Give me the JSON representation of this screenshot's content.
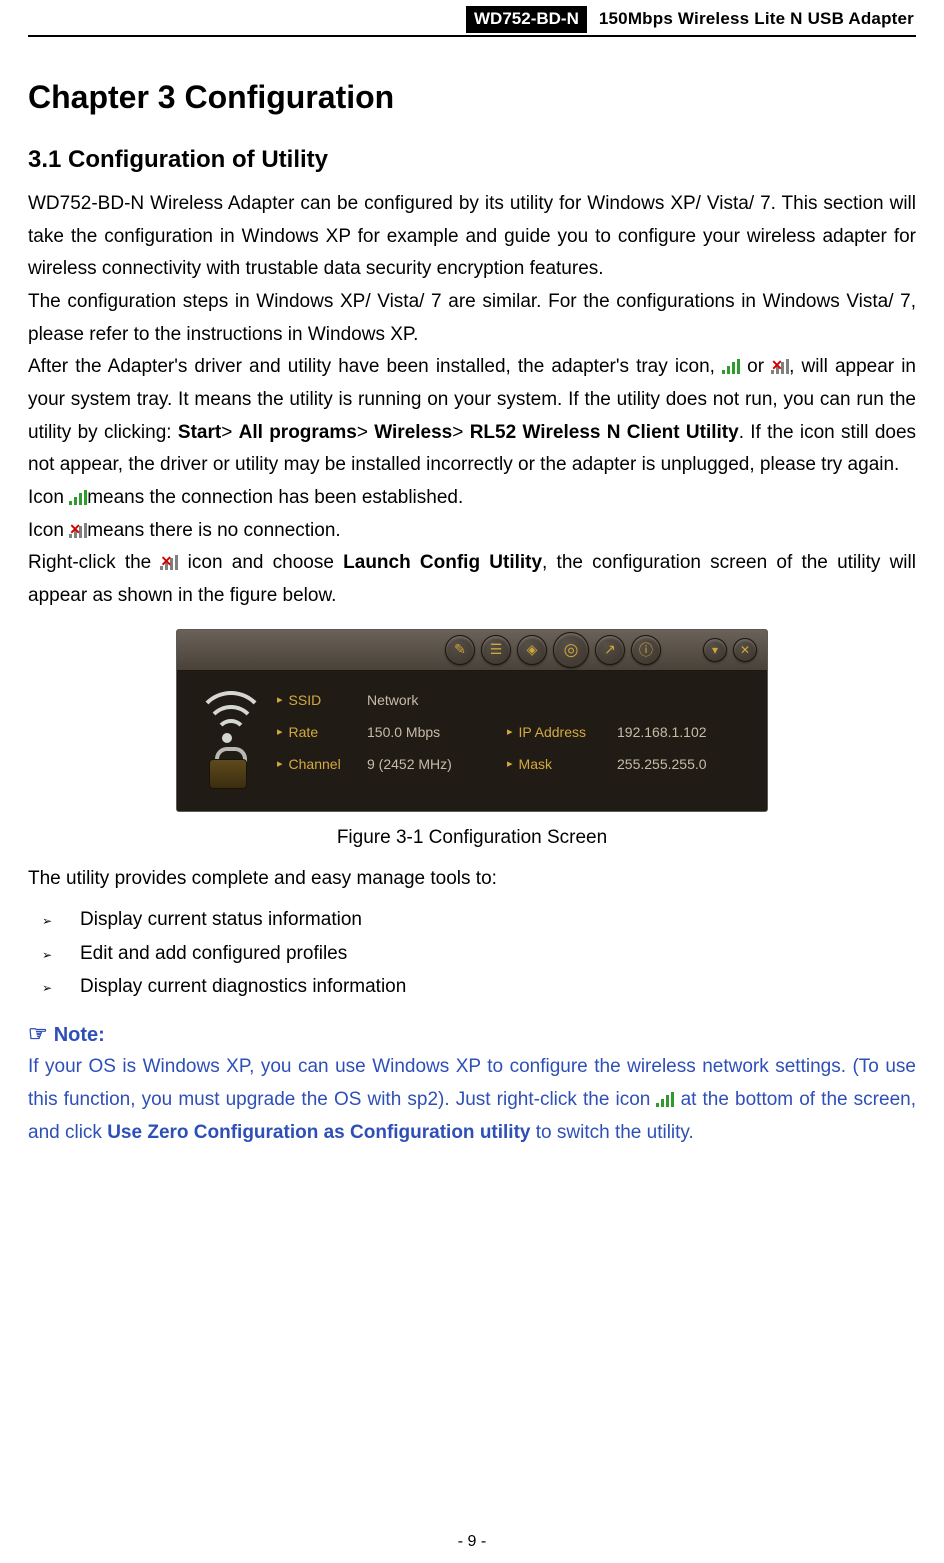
{
  "header": {
    "model": "WD752-BD-N",
    "description": "150Mbps Wireless Lite N USB Adapter"
  },
  "chapter_title": "Chapter 3   Configuration",
  "section_title": "3.1   Configuration of Utility",
  "para1_a": "WD752-BD-N Wireless Adapter can be configured by its utility for Windows XP/ Vista/ 7. This section will take the configuration in Windows XP for example and guide you to configure your wireless adapter for wireless connectivity with trustable data security encryption features.",
  "para2": "The configuration steps in Windows XP/ Vista/ 7 are similar. For the configurations in Windows Vista/ 7, please refer to the instructions in Windows XP.",
  "para3_a": "After the Adapter's driver and utility have been installed, the adapter's tray icon, ",
  "para3_b": " or ",
  "para3_c": ", will appear in your system tray. It means the utility is running on your system. If the utility does not run, you can run the utility by clicking: ",
  "para3_bold1": "Start",
  "para3_gt1": "> ",
  "para3_bold2": "All programs",
  "para3_gt2": "> ",
  "para3_bold3": "Wireless",
  "para3_gt3": "> ",
  "para3_bold4": "RL52 Wireless N Client Utility",
  "para3_d": ". If the icon still does not appear, the driver or utility may be installed incorrectly or the adapter is unplugged, please try again.",
  "line_icon1_a": "Icon ",
  "line_icon1_b": "means the connection has been established.",
  "line_icon2_a": "Icon ",
  "line_icon2_b": "means there is no connection.",
  "para4_a": "Right-click the ",
  "para4_b": " icon and choose ",
  "para4_bold": "Launch Config Utility",
  "para4_c": ", the configuration screen of the utility will appear as shown in the figure below.",
  "utility": {
    "ssid_label": "SSID",
    "ssid_value": "Network",
    "rate_label": "Rate",
    "rate_value": "150.0 Mbps",
    "channel_label": "Channel",
    "channel_value": "9 (2452 MHz)",
    "ip_label": "IP Address",
    "ip_value": "192.168.1.102",
    "mask_label": "Mask",
    "mask_value": "255.255.255.0"
  },
  "figure_caption": "Figure 3-1 Configuration Screen",
  "tools_intro": "The utility provides complete and easy manage tools to:",
  "bullets": [
    "Display current status information",
    "Edit and add configured profiles",
    "Display current diagnostics information"
  ],
  "note_label": "Note:",
  "note_a": "If your OS is Windows XP, you can use Windows XP to configure the wireless network settings. (To use this function, you must upgrade the OS with sp2). Just right-click the icon ",
  "note_b": " at the bottom of the screen, and click ",
  "note_bold": "Use Zero Configuration as Configuration utility",
  "note_c": " to switch the utility.",
  "page_number": "- 9 -"
}
